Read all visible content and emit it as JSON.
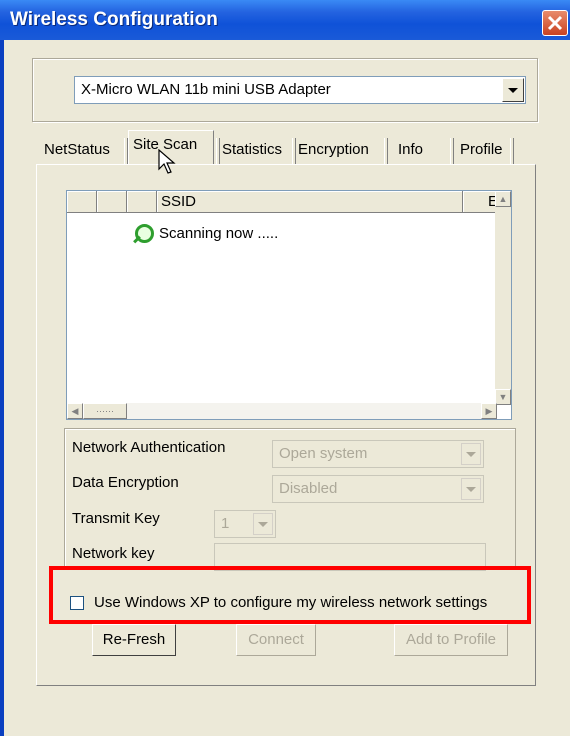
{
  "window": {
    "title": "Wireless Configuration"
  },
  "adapter": {
    "selected": "X-Micro WLAN 11b mini USB Adapter"
  },
  "tabs": [
    {
      "label": "NetStatus"
    },
    {
      "label": "Site Scan",
      "active": true
    },
    {
      "label": "Statistics"
    },
    {
      "label": "Encryption"
    },
    {
      "label": "Info"
    },
    {
      "label": "Profile"
    }
  ],
  "list": {
    "headers": [
      "",
      "",
      "",
      "SSID",
      "E"
    ],
    "scan_status": "Scanning now ....."
  },
  "settings": {
    "auth_label": "Network Authentication",
    "auth_value": "Open system",
    "encryption_label": "Data Encryption",
    "encryption_value": "Disabled",
    "transmit_key_label": "Transmit Key",
    "transmit_key_value": "1",
    "network_key_label": "Network key",
    "network_key_value": ""
  },
  "use_xp": {
    "label": "Use Windows XP to configure my wireless network settings",
    "checked": false
  },
  "buttons": {
    "refresh": "Re-Fresh",
    "connect": "Connect",
    "add_profile": "Add to Profile"
  },
  "colors": {
    "highlight": "#ff0000",
    "titlebar": "#0f52d8"
  }
}
